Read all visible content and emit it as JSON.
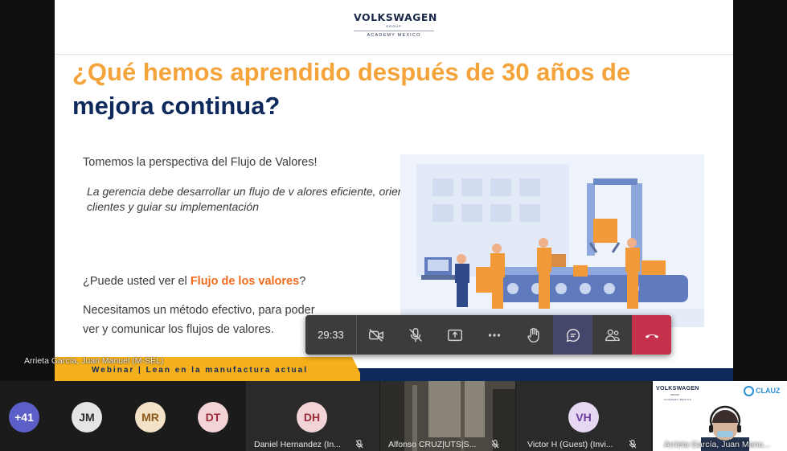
{
  "slide": {
    "logo_brand": "VOLKSWAGEN",
    "logo_group": "GROUP",
    "logo_academy": "ACADEMY MEXICO",
    "title_line1": "¿Qué hemos aprendido después de 30 años de",
    "title_line2": "mejora continua?",
    "intro": "Tomemos la perspectiva del Flujo de Valores!",
    "italic_line1": "La gerencia debe desarrollar un flujo de v alores eficiente, orientado a los",
    "italic_line2": "clientes y guiar su implementación",
    "question_prefix": "¿Puede usted ver el ",
    "question_highlight": "Flujo de los valores",
    "question_suffix": "?",
    "need_line1": "Necesitamos un método efectivo, para poder",
    "need_line2": "ver y comunicar los flujos de valores.",
    "footer": "Webinar | Lean en la manufactura actual"
  },
  "presenter_name": "Arrieta García, Juan Manuel (M-SEL)",
  "controls": {
    "timer": "29:33",
    "buttons": [
      "camera-off",
      "mic-off",
      "share",
      "more",
      "raise-hand",
      "chat",
      "participants",
      "leave"
    ]
  },
  "participants": {
    "overflow": "+41",
    "avatars": [
      {
        "initials": "JM",
        "bg": "#e5e5e5",
        "fg": "#2d2d2d"
      },
      {
        "initials": "MR",
        "bg": "#f4e2c8",
        "fg": "#8c5a18"
      },
      {
        "initials": "DT",
        "bg": "#f3d4d6",
        "fg": "#9c2a3b"
      }
    ],
    "tiles": [
      {
        "initials": "DH",
        "name": "Daniel Hernandez (In..."
      },
      {
        "initials": "",
        "name": "Alfonso CRUZ|UTS|S..."
      },
      {
        "initials": "VH",
        "name": "Victor H (Guest) (Invi..."
      },
      {
        "initials": "",
        "name": "Arrieta García, Juan Manu..."
      }
    ]
  },
  "mini_slide": {
    "brand": "VOLKSWAGEN",
    "group": "GROUP",
    "academy": "ACADEMY MEXICO",
    "partner": "CLAUZ"
  },
  "colors": {
    "title_orange": "#f4a43a",
    "title_navy": "#0e2a5c",
    "accent": "#f26a1b",
    "leave_red": "#c4314b",
    "overflow_avatar": "#5b5fc7"
  }
}
